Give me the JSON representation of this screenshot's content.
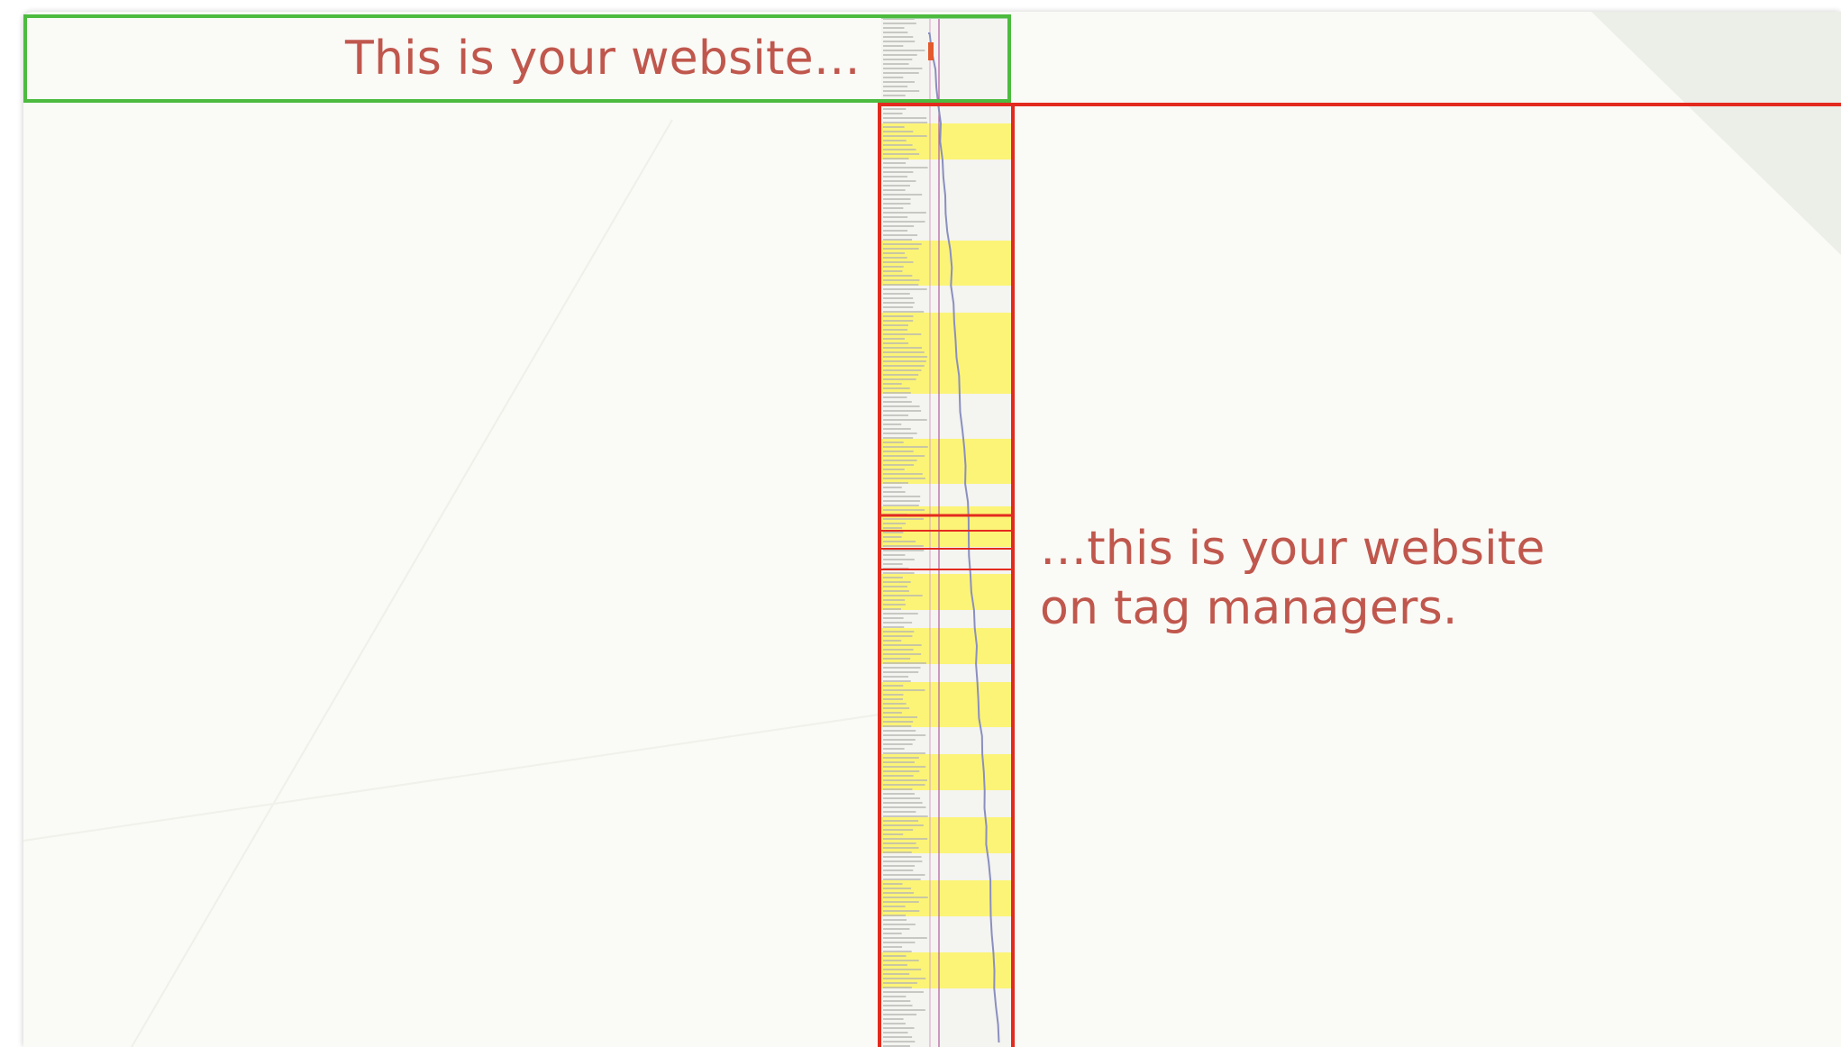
{
  "captions": {
    "top": "This is your website…",
    "bottom_line1": "…this is your website",
    "bottom_line2": "on tag managers."
  },
  "colors": {
    "background": "#fafaf6",
    "green_frame": "#4cbb3f",
    "red_frame": "#e32a1e",
    "caption_text": "#c0574d",
    "highlight_rows": "#fff44f"
  }
}
